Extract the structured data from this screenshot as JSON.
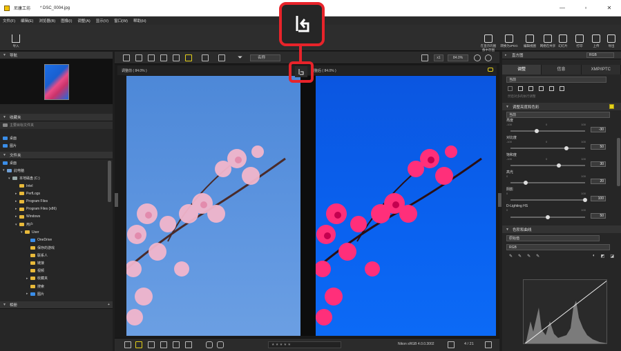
{
  "app": {
    "title": "尼康工坊",
    "file": "* DSC_0004.jpg"
  },
  "menu": [
    "文件(F)",
    "编辑(E)",
    "浏览器(B)",
    "图像(I)",
    "调整(A)",
    "显示(V)",
    "窗口(W)",
    "帮助(H)"
  ],
  "toolbar": {
    "import": "导入",
    "tools": [
      "在显示的图像中存图",
      "转换为JPEG",
      "编辑视图",
      "网络在共享",
      "幻灯片",
      "打印",
      "上传",
      "导出"
    ]
  },
  "left": {
    "nav_title": "导航",
    "favorites_title": "收藏夹",
    "favorites_hint": "主要目标文件夹",
    "fav_items": [
      "桌面",
      "图片"
    ],
    "folders_title": "文件夹",
    "tree": [
      "桌面",
      "此电脑",
      "本地磁盘 (C:)",
      "Intel",
      "PerfLogs",
      "Program Files",
      "Program Files (x86)",
      "Windows",
      "用户",
      "User",
      "OneDrive",
      "保存的游戏",
      "联系人",
      "链接",
      "视频",
      "收藏夹",
      "搜索",
      "图片"
    ],
    "album_title": "相册"
  },
  "center": {
    "sort_label": "名称",
    "zoom_mode": "x1",
    "zoom": "84.0%",
    "left_caption": "调整前 ( 84.0% )",
    "right_caption": "调整后 ( 84.0% )",
    "profile": "Nikon sRGB 4.0.0.3002",
    "counter": "4 / 21"
  },
  "right": {
    "histogram_title": "直方图",
    "histogram_mode": "RGB",
    "tabs": [
      "调整",
      "信息",
      "XMP/IPTC"
    ],
    "preset": "当前",
    "apply_label": "然后对多的执行调整",
    "brightness_section": "调整亮度和色彩",
    "brightness_mode": "当前",
    "sliders": [
      {
        "label": "亮度",
        "min": "-100",
        "mid": "0",
        "max": "100",
        "value": "-30",
        "pos": 0.35
      },
      {
        "label": "对比度",
        "min": "-100",
        "mid": "0",
        "max": "100",
        "value": "50",
        "pos": 0.75
      },
      {
        "label": "饱和度",
        "min": "-100",
        "mid": "0",
        "max": "100",
        "value": "30",
        "pos": 0.65
      },
      {
        "label": "高光",
        "min": "0",
        "mid": "",
        "max": "100",
        "value": "20",
        "pos": 0.2
      },
      {
        "label": "阴影",
        "min": "0",
        "mid": "",
        "max": "100",
        "value": "100",
        "pos": 1.0
      },
      {
        "label": "D-Lighting HS",
        "min": "0",
        "mid": "",
        "max": "100",
        "value": "50",
        "pos": 0.5
      }
    ],
    "curves_section": "色阶和曲线",
    "curves_preset": "原始值",
    "curves_channel": "RGB"
  }
}
